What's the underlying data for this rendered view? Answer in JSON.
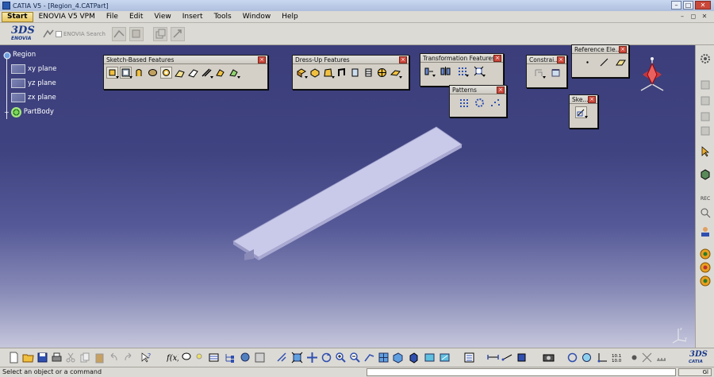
{
  "window": {
    "title": "CATIA V5 - [Region_4.CATPart]",
    "controls": {
      "minimize": "–",
      "maximize": "□",
      "close": "✕"
    }
  },
  "menubar": {
    "start": "Start",
    "items": [
      "ENOVIA V5 VPM",
      "File",
      "Edit",
      "View",
      "Insert",
      "Tools",
      "Window",
      "Help"
    ],
    "mdi_controls": {
      "minimize": "–",
      "restore": "◻",
      "close": "✕"
    }
  },
  "top_toolbar": {
    "logo_mark": "3DS",
    "logo_text": "ENOVIA",
    "enovia_search_label": "ENOVIA Search"
  },
  "tree": {
    "root": "Region",
    "items": [
      "xy plane",
      "yz plane",
      "zx plane",
      "PartBody"
    ]
  },
  "toolbars": {
    "sketch_based": "Sketch-Based Features",
    "dress_up": "Dress-Up Features",
    "transformation": "Transformation Features",
    "patterns": "Patterns",
    "constraints": "Constrai...",
    "reference": "Reference Ele...",
    "sketcher": "Ske..."
  },
  "status": {
    "message": "Select an object or a command",
    "button": "Gl"
  },
  "colors": {
    "viewport_top": "#3b3e7a",
    "viewport_bottom": "#c6c7dc",
    "part_face": "#c9c9ea",
    "part_side": "#9a9ac6",
    "close_button": "#cc4a3e"
  }
}
